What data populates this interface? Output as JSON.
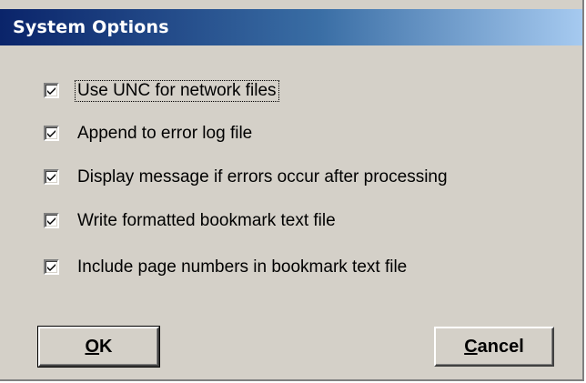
{
  "dialog": {
    "title": "System Options"
  },
  "options": [
    {
      "label": "Use UNC for network files",
      "checked": true
    },
    {
      "label": "Append to error log file",
      "checked": true
    },
    {
      "label": "Display message if errors occur after processing",
      "checked": true
    },
    {
      "label": "Write formatted bookmark text file",
      "checked": true
    },
    {
      "label": "Include page numbers in bookmark text file",
      "checked": true
    }
  ],
  "buttons": {
    "ok": {
      "mnemonic": "O",
      "rest": "K"
    },
    "cancel": {
      "mnemonic": "C",
      "rest": "ancel"
    }
  }
}
